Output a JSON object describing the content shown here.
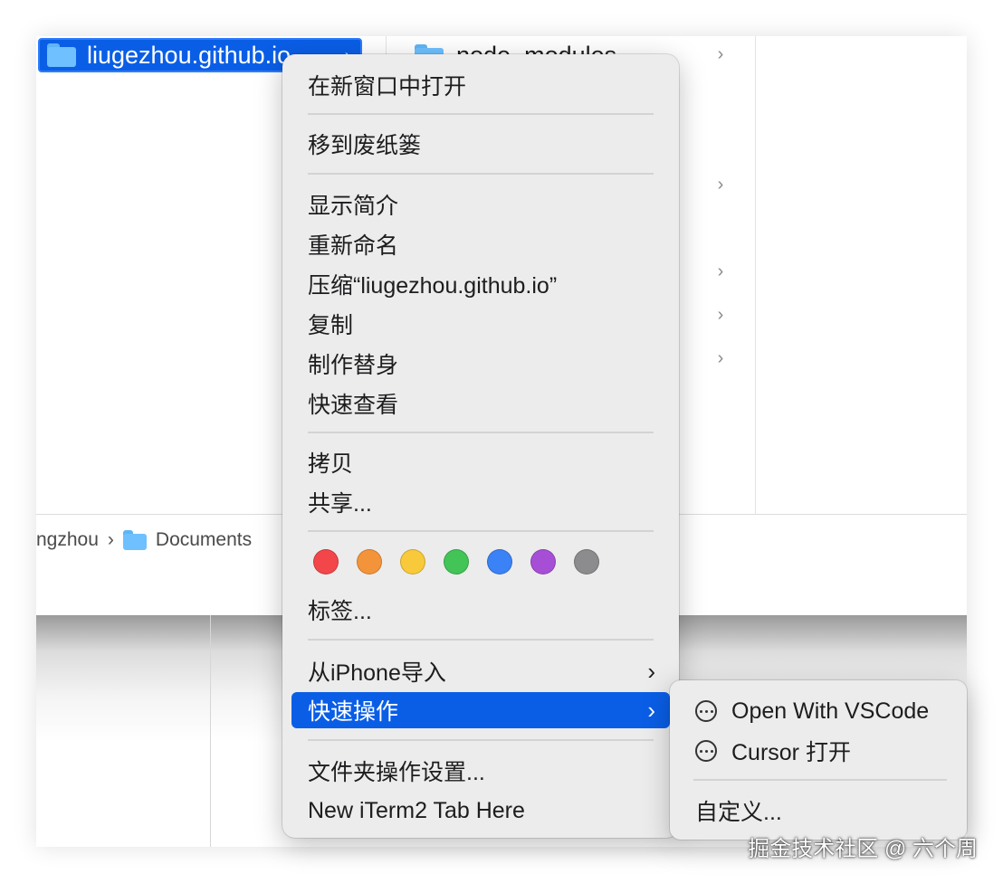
{
  "finder": {
    "selected_folder": "liugezhou.github.io",
    "column2_first": "node_modules",
    "path_user_fragment": "ngzhou",
    "path_documents": "Documents"
  },
  "context_menu": {
    "open_new_window": "在新窗口中打开",
    "move_to_trash": "移到废纸篓",
    "get_info": "显示简介",
    "rename": "重新命名",
    "compress": "压缩“liugezhou.github.io”",
    "duplicate": "复制",
    "make_alias": "制作替身",
    "quick_look": "快速查看",
    "copy": "拷贝",
    "share": "共享...",
    "tag_colors": [
      "#f2464a",
      "#f4943a",
      "#f8c93b",
      "#42c456",
      "#3a82f6",
      "#a64fd6",
      "#8c8c8e"
    ],
    "tags": "标签...",
    "import_iphone": "从iPhone导入",
    "quick_actions": "快速操作",
    "folder_actions": "文件夹操作设置...",
    "new_iterm": "New iTerm2 Tab Here"
  },
  "submenu": {
    "open_vscode": "Open With VSCode",
    "cursor_open": "Cursor 打开",
    "customize": "自定义..."
  },
  "watermark": "掘金技术社区 @ 六个周"
}
